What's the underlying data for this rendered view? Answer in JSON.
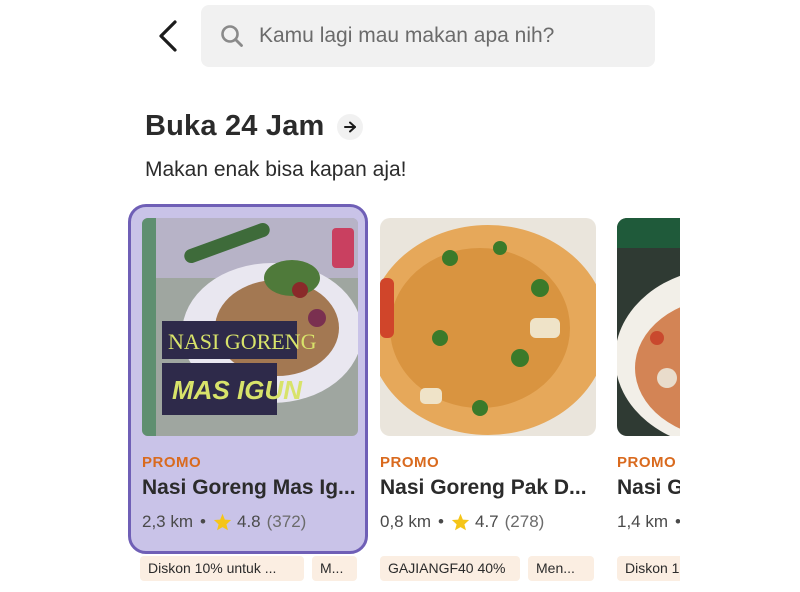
{
  "search": {
    "placeholder": "Kamu lagi mau makan apa nih?"
  },
  "section": {
    "title": "Buka 24 Jam",
    "subtitle": "Makan enak bisa kapan aja!"
  },
  "cards": [
    {
      "image_text_line1": "NASI GORENG",
      "image_text_line2": "MAS IGUN",
      "promo": "PROMO",
      "name": "Nasi Goreng Mas Ig...",
      "distance": "2,3 km",
      "rating": "4.8",
      "reviews": "(372)",
      "tags": [
        "Diskon 10% untuk ...",
        "M..."
      ]
    },
    {
      "promo": "PROMO",
      "name": "Nasi Goreng Pak D...",
      "distance": "0,8 km",
      "rating": "4.7",
      "reviews": "(278)",
      "tags": [
        "GAJIANGF40 40%",
        "Men..."
      ]
    },
    {
      "promo": "PROMO",
      "name": "Nasi G",
      "distance": "1,4 km",
      "tags": [
        "Diskon 1"
      ]
    }
  ],
  "colors": {
    "promo": "#d96a1e",
    "selected_border": "#6f5fb6",
    "selected_bg": "#c9c3e8",
    "star": "#f5c518",
    "tag_bg": "#fbeee2"
  }
}
